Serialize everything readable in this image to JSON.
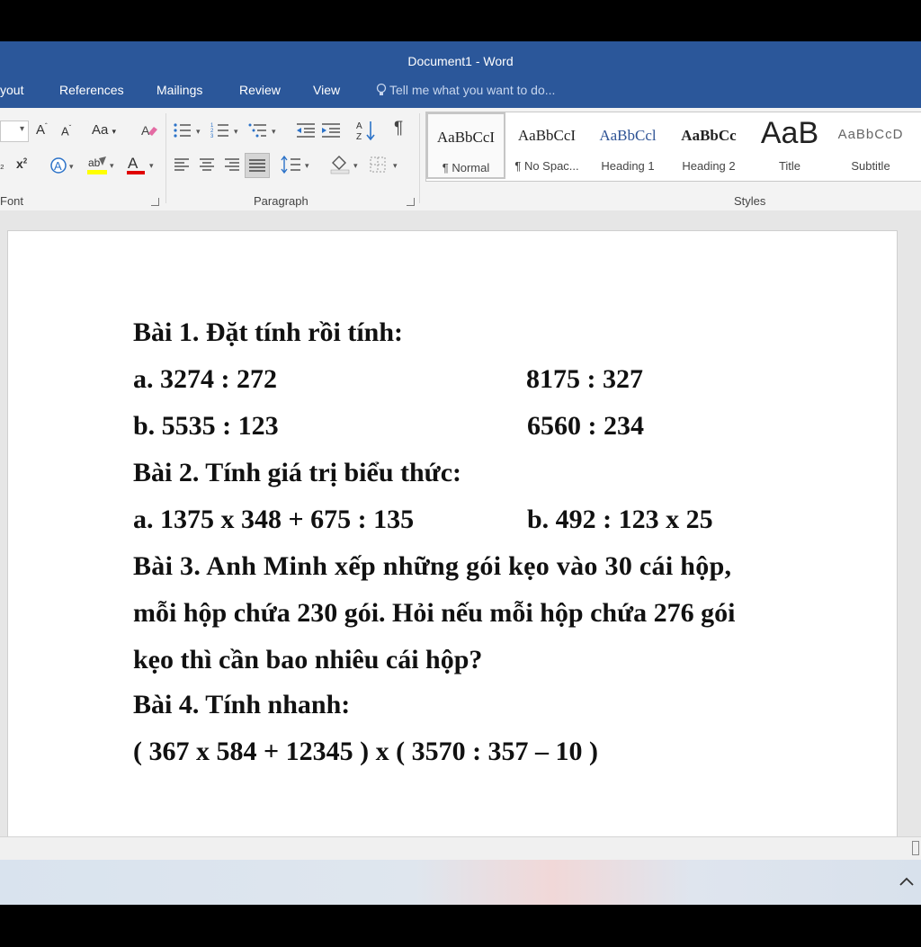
{
  "window": {
    "title": "Document1 - Word"
  },
  "tabs": [
    "yout",
    "References",
    "Mailings",
    "Review",
    "View"
  ],
  "tell_me": "Tell me what you want to do...",
  "ribbon": {
    "groups": {
      "font": "Font",
      "paragraph": "Paragraph",
      "styles": "Styles"
    },
    "font_buttons": {
      "grow": "A",
      "shrink": "A",
      "change_case": "Aa",
      "superscript": "x",
      "text_effects": "A",
      "font_color": "A",
      "highlight": "ab"
    }
  },
  "styles": [
    {
      "sample": "AaBbCcI",
      "name": "¶ Normal"
    },
    {
      "sample": "AaBbCcI",
      "name": "¶ No Spac..."
    },
    {
      "sample": "AaBbCcl",
      "name": "Heading 1"
    },
    {
      "sample": "AaBbCc",
      "name": "Heading 2"
    },
    {
      "sample": "AaB",
      "name": "Title"
    },
    {
      "sample": "AaBbCcD",
      "name": "Subtitle"
    }
  ],
  "document": {
    "bai1_title": "Bài 1. Đặt tính rồi tính:",
    "bai1_a1": "a. 3274 : 272",
    "bai1_a2": "8175 : 327",
    "bai1_b1": "b. 5535 : 123",
    "bai1_b2": "6560 : 234",
    "bai2_title": "Bài 2. Tính giá trị biểu thức:",
    "bai2_a": "a. 1375 x 348 + 675 : 135",
    "bai2_b": "b. 492 : 123 x 25",
    "bai3_l1": "Bài 3. Anh Minh xếp những gói kẹo vào 30 cái hộp,",
    "bai3_l2": "mỗi hộp chứa 230 gói. Hỏi nếu mỗi hộp chứa 276 gói",
    "bai3_l3": "kẹo thì cần bao nhiêu cái hộp?",
    "bai4_title": "Bài 4. Tính nhanh:",
    "bai4_expr": "( 367 x 584 + 12345 ) x ( 3570 : 357 – 10 )"
  },
  "colors": {
    "title_bar": "#2b579a",
    "ribbon": "#f3f3f3",
    "font_color_red": "#e00000",
    "highlight_yellow": "#ffff00"
  }
}
